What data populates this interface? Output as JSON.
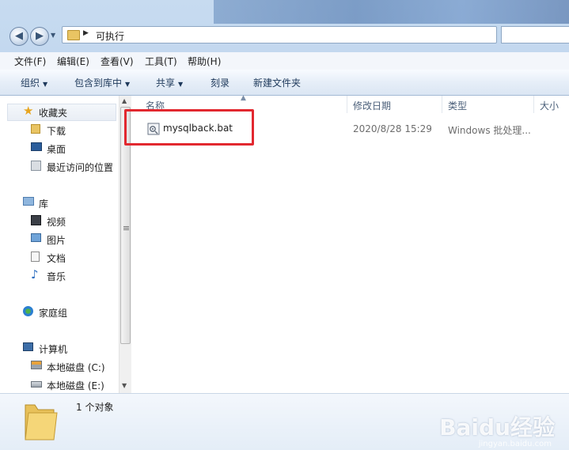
{
  "address": {
    "path": "可执行"
  },
  "menu": [
    "文件(F)",
    "编辑(E)",
    "查看(V)",
    "工具(T)",
    "帮助(H)"
  ],
  "commands": {
    "organize": "组织",
    "include_in_library": "包含到库中",
    "share": "共享",
    "burn": "刻录",
    "new_folder": "新建文件夹"
  },
  "nav": {
    "favorites": "收藏夹",
    "downloads": "下载",
    "desktop": "桌面",
    "recent": "最近访问的位置",
    "libraries": "库",
    "videos": "视频",
    "pictures": "图片",
    "documents": "文档",
    "music": "音乐",
    "homegroup": "家庭组",
    "computer": "计算机",
    "drive_c": "本地磁盘 (C:)",
    "drive_e": "本地磁盘 (E:)"
  },
  "columns": {
    "name": "名称",
    "modified": "修改日期",
    "type": "类型",
    "size": "大小"
  },
  "files": [
    {
      "name": "mysqlback.bat",
      "modified": "2020/8/28 15:29",
      "type": "Windows 批处理..."
    }
  ],
  "status": {
    "item_count": "1 个对象"
  },
  "watermark": {
    "main": "Baidu经验",
    "sub": "jingyan.baidu.com"
  },
  "colors": {
    "highlight": "#e2282f",
    "accent": "#1e395b"
  }
}
